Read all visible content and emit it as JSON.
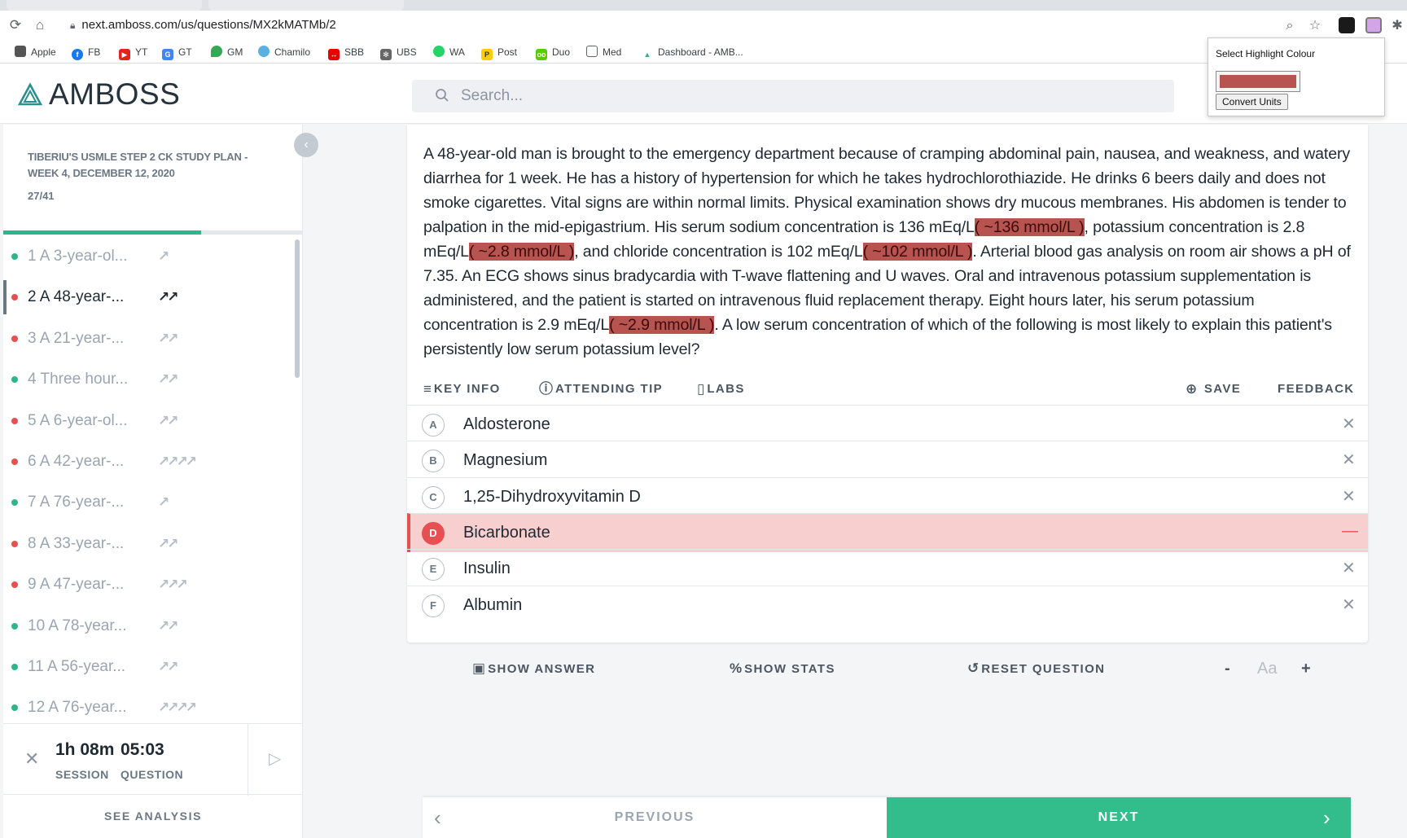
{
  "browser": {
    "url": "next.amboss.com/us/questions/MX2kMATMb/2",
    "bookmarks": [
      "Apple",
      "FB",
      "YT",
      "GT",
      "GM",
      "Chamilo",
      "SBB",
      "UBS",
      "WA",
      "Post",
      "Duo",
      "Med",
      "Dashboard - AMB..."
    ]
  },
  "highlight_popup": {
    "title": "Select Highlight Colour",
    "color": "#b85450",
    "convert_button": "Convert Units"
  },
  "header": {
    "logo": "AMBOSS",
    "search_placeholder": "Search..."
  },
  "sidebar": {
    "plan_title": "TIBERIU'S USMLE STEP 2 CK STUDY PLAN - WEEK 4, DECEMBER 12, 2020",
    "count": "27/41",
    "progress_fraction": 0.66,
    "questions": [
      {
        "label": "1  A 3-year-ol...",
        "status": "correct",
        "difficulty": 1
      },
      {
        "label": "2  A 48-year-...",
        "status": "incorrect",
        "difficulty": 2,
        "active": true
      },
      {
        "label": "3  A 21-year-...",
        "status": "incorrect",
        "difficulty": 2
      },
      {
        "label": "4  Three hour...",
        "status": "correct",
        "difficulty": 2
      },
      {
        "label": "5  A 6-year-ol...",
        "status": "incorrect",
        "difficulty": 2
      },
      {
        "label": "6  A 42-year-...",
        "status": "incorrect",
        "difficulty": 4
      },
      {
        "label": "7  A 76-year-...",
        "status": "correct",
        "difficulty": 1
      },
      {
        "label": "8  A 33-year-...",
        "status": "incorrect",
        "difficulty": 2
      },
      {
        "label": "9  A 47-year-...",
        "status": "incorrect",
        "difficulty": 3
      },
      {
        "label": "10  A 78-year...",
        "status": "correct",
        "difficulty": 2
      },
      {
        "label": "11  A 56-year...",
        "status": "correct",
        "difficulty": 2
      },
      {
        "label": "12  A 76-year...",
        "status": "correct",
        "difficulty": 4
      }
    ],
    "timer": {
      "session_value": "1h 08m",
      "session_label": "SESSION",
      "question_value": "05:03",
      "question_label": "QUESTION"
    },
    "see_analysis": "SEE ANALYSIS"
  },
  "question": {
    "stem_parts": [
      {
        "t": "A 48-year-old man is brought to the emergency department because of cramping abdominal pain, nausea, and weakness, and watery diarrhea for 1 week. He has a history of hypertension for which he takes hydrochlorothiazide. He drinks 6 beers daily and does not smoke cigarettes. Vital signs are within normal limits. Physical examination shows dry mucous membranes. His abdomen is tender to palpation in the mid-epigastrium. His serum sodium concentration is 136 mEq/L"
      },
      {
        "t": "( ~136 mmol/L )",
        "hl": true
      },
      {
        "t": ", potassium concentration is 2.8 mEq/L"
      },
      {
        "t": "( ~2.8 mmol/L )",
        "hl": true
      },
      {
        "t": ", and chloride concentration is 102 mEq/L"
      },
      {
        "t": "( ~102 mmol/L )",
        "hl": true
      },
      {
        "t": ". Arterial blood gas analysis on room air shows a pH of 7.35. An ECG shows sinus bradycardia with T-wave flattening and U waves. Oral and intravenous potassium supplementation is administered, and the patient is started on intravenous fluid replacement therapy. Eight hours later, his serum potassium concentration is 2.9 mEq/L"
      },
      {
        "t": "( ~2.9 mmol/L )",
        "hl": true
      },
      {
        "t": ". A low serum concentration of which of the following is most likely to explain this patient's persistently low serum potassium level?"
      }
    ],
    "tools": {
      "key_info": "KEY INFO",
      "attending_tip": "ATTENDING TIP",
      "labs": "LABS",
      "save": "SAVE",
      "feedback": "FEEDBACK"
    },
    "answers": [
      {
        "letter": "A",
        "text": "Aldosterone"
      },
      {
        "letter": "B",
        "text": "Magnesium"
      },
      {
        "letter": "C",
        "text": "1,25-Dihydroxyvitamin D"
      },
      {
        "letter": "D",
        "text": "Bicarbonate",
        "selected": true
      },
      {
        "letter": "E",
        "text": "Insulin"
      },
      {
        "letter": "F",
        "text": "Albumin"
      }
    ]
  },
  "actions": {
    "show_answer": "SHOW ANSWER",
    "show_stats": "SHOW STATS",
    "reset_question": "RESET QUESTION",
    "font_minus": "-",
    "font_label": "Aa",
    "font_plus": "+"
  },
  "navigation": {
    "previous": "PREVIOUS",
    "next": "NEXT"
  },
  "colors": {
    "correct": "#2fb58a",
    "incorrect": "#e65050",
    "accent": "#33bd8c"
  }
}
